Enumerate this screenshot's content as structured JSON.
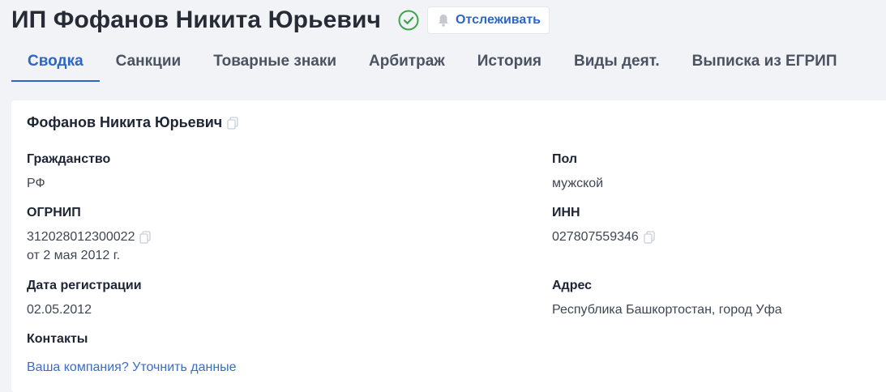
{
  "header": {
    "title": "ИП Фофанов Никита Юрьевич",
    "track_label": "Отслеживать"
  },
  "tabs": [
    {
      "label": "Сводка",
      "active": true
    },
    {
      "label": "Санкции"
    },
    {
      "label": "Товарные знаки"
    },
    {
      "label": "Арбитраж"
    },
    {
      "label": "История"
    },
    {
      "label": "Виды деят."
    },
    {
      "label": "Выписка из ЕГРИП"
    }
  ],
  "card": {
    "name": "Фофанов Никита Юрьевич",
    "citizenship": {
      "label": "Гражданство",
      "value": "РФ"
    },
    "gender": {
      "label": "Пол",
      "value": "мужской"
    },
    "ogrnip": {
      "label": "ОГРНИП",
      "value": "312028012300022",
      "date": "от 2 мая 2012 г."
    },
    "inn": {
      "label": "ИНН",
      "value": "027807559346"
    },
    "registration_date": {
      "label": "Дата регистрации",
      "value": "02.05.2012"
    },
    "address": {
      "label": "Адрес",
      "value": "Республика Башкортостан, город Уфа"
    },
    "contacts": {
      "label": "Контакты",
      "link": "Ваша компания? Уточнить данные"
    }
  },
  "colors": {
    "accent": "#2d66c5",
    "verified": "#3fa34d",
    "background": "#f1f3f6"
  }
}
